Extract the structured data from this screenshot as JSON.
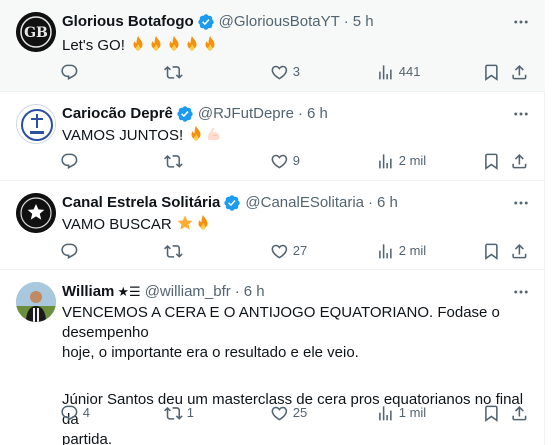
{
  "tweets": [
    {
      "name": "Glorious Botafogo",
      "handle": "@GloriousBotaYT",
      "time": "5 h",
      "text_lines": [
        "Let's GO!"
      ],
      "emoji_count": 5,
      "emoji_tail": "fire",
      "replies": "",
      "reposts": "",
      "likes": "3",
      "views": "441",
      "avatar_text": "GB"
    },
    {
      "name": "Cariocão Deprê",
      "handle": "@RJFutDepre",
      "time": "6 h",
      "text_lines": [
        "VAMOS JUNTOS!"
      ],
      "emoji_tail": "fire-flex",
      "replies": "",
      "reposts": "",
      "likes": "9",
      "views": "2 mil"
    },
    {
      "name": "Canal Estrela Solitária",
      "handle": "@CanalESolitaria",
      "time": "6 h",
      "text_lines": [
        "VAMO BUSCAR"
      ],
      "emoji_tail": "star-fire",
      "replies": "",
      "reposts": "",
      "likes": "27",
      "views": "2 mil"
    },
    {
      "name": "William",
      "handle": "@william_bfr",
      "time": "6 h",
      "text_lines": [
        "VENCEMOS A CERA E O ANTIJOGO EQUATORIANO. Fodase o desempenho",
        "hoje, o importante era o resultado e ele veio.",
        "",
        "Júnior Santos deu um masterclass de cera pros equatorianos no final da",
        "partida."
      ],
      "name_badges": "★☰",
      "replies": "4",
      "reposts": "1",
      "likes": "25",
      "views": "1 mil"
    }
  ],
  "icons": {
    "reply": "reply-icon",
    "repost": "repost-icon",
    "like": "like-icon",
    "views": "views-icon",
    "bookmark": "bookmark-icon",
    "share": "share-icon",
    "more": "more-icon",
    "verified": "verified-icon"
  },
  "colors": {
    "text": "#0f1419",
    "secondary": "#536471",
    "verified": "#1d9bf0",
    "highlight_bg": "#f7f9f9",
    "border": "#eff3f4"
  }
}
